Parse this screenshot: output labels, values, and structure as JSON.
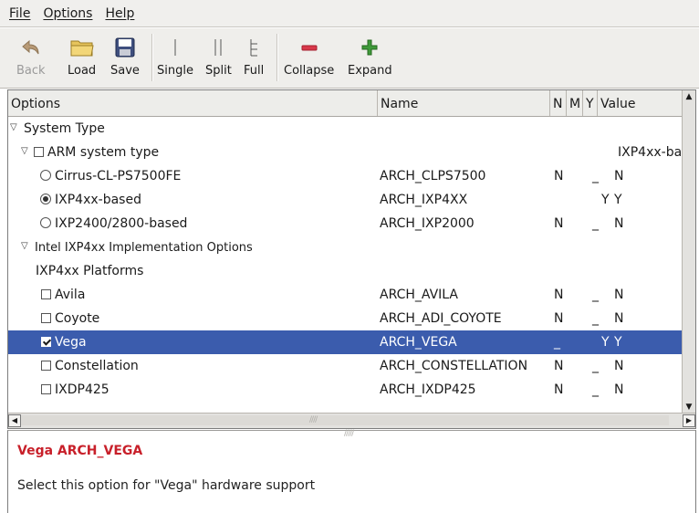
{
  "menu": {
    "file": "File",
    "options": "Options",
    "help": "Help"
  },
  "toolbar": {
    "back": "Back",
    "load": "Load",
    "save": "Save",
    "single": "Single",
    "split": "Split",
    "full": "Full",
    "collapse": "Collapse",
    "expand": "Expand"
  },
  "columns": {
    "options": "Options",
    "name": "Name",
    "n": "N",
    "m": "M",
    "y": "Y",
    "value": "Value"
  },
  "rows": [
    {
      "label": "System Type",
      "name": "",
      "n": "",
      "m": "",
      "y": "",
      "value": ""
    },
    {
      "label": "ARM system type",
      "name": "",
      "n": "",
      "m": "",
      "y": "",
      "value": "IXP4xx-ba"
    },
    {
      "label": "Cirrus-CL-PS7500FE",
      "name": "ARCH_CLPS7500",
      "n": "N",
      "m": "_",
      "y": "",
      "value": "N"
    },
    {
      "label": "IXP4xx-based",
      "name": "ARCH_IXP4XX",
      "n": "",
      "m": "",
      "y": "Y",
      "value": "Y"
    },
    {
      "label": "IXP2400/2800-based",
      "name": "ARCH_IXP2000",
      "n": "N",
      "m": "_",
      "y": "",
      "value": "N"
    },
    {
      "label": "Intel IXP4xx Implementation Options",
      "name": "",
      "n": "",
      "m": "",
      "y": "",
      "value": ""
    },
    {
      "label": "IXP4xx Platforms",
      "name": "",
      "n": "",
      "m": "",
      "y": "",
      "value": ""
    },
    {
      "label": "Avila",
      "name": "ARCH_AVILA",
      "n": "N",
      "m": "_",
      "y": "",
      "value": "N"
    },
    {
      "label": "Coyote",
      "name": "ARCH_ADI_COYOTE",
      "n": "N",
      "m": "_",
      "y": "",
      "value": "N"
    },
    {
      "label": "Vega",
      "name": "ARCH_VEGA",
      "n": "_",
      "m": "",
      "y": "Y",
      "value": "Y"
    },
    {
      "label": "Constellation",
      "name": "ARCH_CONSTELLATION",
      "n": "N",
      "m": "_",
      "y": "",
      "value": "N"
    },
    {
      "label": "IXDP425",
      "name": "ARCH_IXDP425",
      "n": "N",
      "m": "_",
      "y": "",
      "value": "N"
    }
  ],
  "info": {
    "title": "Vega ARCH_VEGA",
    "text": "Select this option for \"Vega\" hardware support"
  },
  "colors": {
    "selection": "#3b5cad",
    "info_title": "#c8202a",
    "collapse_icon": "#d8384a",
    "expand_icon": "#3f9a3a"
  },
  "icons": [
    "back-arrow-icon",
    "folder-icon",
    "floppy-disk-icon",
    "collapse-minus-icon",
    "expand-plus-icon",
    "expander-arrow-icon",
    "checkbox-icon",
    "radio-icon"
  ]
}
